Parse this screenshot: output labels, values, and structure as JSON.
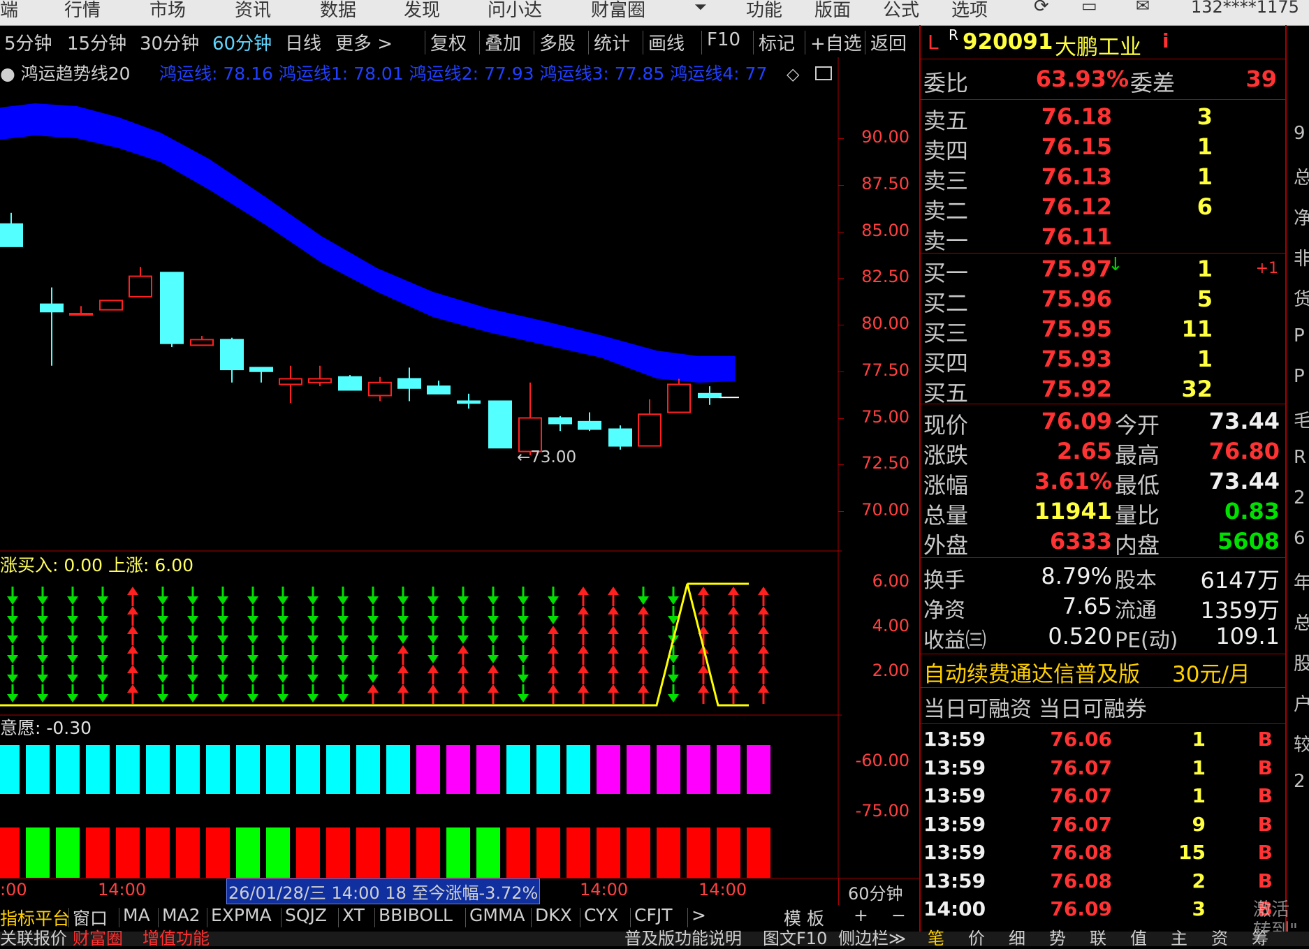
{
  "menu": [
    "端",
    "行情",
    "市场",
    "资讯",
    "数据",
    "发现",
    "问小达",
    "财富圈",
    "功能",
    "版面",
    "公式",
    "选项"
  ],
  "menu_dropdown_glyph": "⏷",
  "user": "132****1175",
  "periods": [
    "5分钟",
    "15分钟",
    "30分钟",
    "60分钟",
    "日线",
    "更多 >"
  ],
  "active_period": "60分钟",
  "toolbar_buttons": [
    "复权",
    "叠加",
    "多股",
    "统计",
    "画线",
    "F10",
    "标记",
    "+自选",
    "返回"
  ],
  "indicator_name": "鸿运趋势线20",
  "indicator_values": "鸿运线: 78.16  鸿运线1: 78.01  鸿运线2: 77.93  鸿运线3: 77.85  鸿运线4: 77",
  "main_axis": [
    "90.00",
    "87.50",
    "85.00",
    "82.50",
    "80.00",
    "77.50",
    "75.00",
    "72.50",
    "70.00"
  ],
  "low_marker": "←73.00",
  "ind1_title": "涨买入: 0.00  上涨: 6.00",
  "ind1_axis": [
    "6.00",
    "4.00",
    "2.00"
  ],
  "ind2_title": "意愿: -0.30",
  "ind2_axis": [
    "-60.00",
    "-75.00"
  ],
  "time_axis": [
    ":00",
    "14:00",
    "14:00",
    "14:00"
  ],
  "time_info": "26/01/28/三 14:00 18 至今涨幅-3.72%",
  "time_period": "60分钟",
  "bottom_tabs": [
    "指标平台",
    "窗口",
    "MA",
    "MA2",
    "EXPMA",
    "SQJZ",
    "XT",
    "BBIBOLL",
    "GMMA",
    "DKX",
    "CYX",
    "CFJT",
    ">"
  ],
  "template_label": "模 板",
  "plus": "+",
  "minus": "−",
  "status_left": [
    "关联报价",
    "财富圈",
    "增值功能"
  ],
  "status_right": [
    "普及版功能说明",
    "图文F10",
    "侧边栏≫"
  ],
  "status_tabs": [
    "笔",
    "价",
    "细",
    "势",
    "联",
    "值",
    "主",
    "资",
    "筹"
  ],
  "quote": {
    "market": "L",
    "flag": "R",
    "code": "920091",
    "name": "大鹏工业",
    "info_icon": "i",
    "wb_label": "委比",
    "wb": "63.93%",
    "wc_label": "委差",
    "wc": "39",
    "asks": [
      {
        "label": "卖五",
        "price": "76.18",
        "vol": "3"
      },
      {
        "label": "卖四",
        "price": "76.15",
        "vol": "1"
      },
      {
        "label": "卖三",
        "price": "76.13",
        "vol": "1"
      },
      {
        "label": "卖二",
        "price": "76.12",
        "vol": "6"
      },
      {
        "label": "卖一",
        "price": "76.11",
        "vol": ""
      }
    ],
    "bids": [
      {
        "label": "买一",
        "price": "75.97",
        "vol": "1",
        "chg": "+1"
      },
      {
        "label": "买二",
        "price": "75.96",
        "vol": "5",
        "chg": ""
      },
      {
        "label": "买三",
        "price": "75.95",
        "vol": "11",
        "chg": ""
      },
      {
        "label": "买四",
        "price": "75.93",
        "vol": "1",
        "chg": ""
      },
      {
        "label": "买五",
        "price": "75.92",
        "vol": "32",
        "chg": ""
      }
    ],
    "stats": [
      {
        "l1": "现价",
        "v1": "76.09",
        "l2": "今开",
        "v2": "73.44"
      },
      {
        "l1": "涨跌",
        "v1": "2.65",
        "l2": "最高",
        "v2": "76.80"
      },
      {
        "l1": "涨幅",
        "v1": "3.61%",
        "l2": "最低",
        "v2": "73.44"
      },
      {
        "l1": "总量",
        "v1": "11941",
        "l2": "量比",
        "v2": "0.83"
      },
      {
        "l1": "外盘",
        "v1": "6333",
        "l2": "内盘",
        "v2": "5608"
      }
    ],
    "stats2": [
      {
        "l1": "换手",
        "v1": "8.79%",
        "l2": "股本",
        "v2": "6147万"
      },
      {
        "l1": "净资",
        "v1": "7.65",
        "l2": "流通",
        "v2": "1359万"
      },
      {
        "l1": "收益㈢",
        "v1": "0.520",
        "l2": "PE(动)",
        "v2": "109.1"
      }
    ],
    "promo": "自动续费通达信普及版",
    "promo_price": "30元/月",
    "margin": "当日可融资 当日可融券",
    "ticks": [
      {
        "t": "13:59",
        "p": "76.06",
        "v": "1",
        "s": "B"
      },
      {
        "t": "13:59",
        "p": "76.07",
        "v": "1",
        "s": "B"
      },
      {
        "t": "13:59",
        "p": "76.07",
        "v": "1",
        "s": "B"
      },
      {
        "t": "13:59",
        "p": "76.07",
        "v": "9",
        "s": "B"
      },
      {
        "t": "13:59",
        "p": "76.08",
        "v": "15",
        "s": "B"
      },
      {
        "t": "13:59",
        "p": "76.08",
        "v": "2",
        "s": "B"
      },
      {
        "t": "14:00",
        "p": "76.09",
        "v": "3",
        "s": "B"
      }
    ]
  },
  "edge_right": [
    "9",
    "总",
    "净",
    "非",
    "货",
    "P",
    "P",
    "毛",
    "R",
    "2",
    "6",
    "年",
    "总",
    "股",
    "户",
    "较",
    "2"
  ],
  "watermark": "激活\n转到\""
}
